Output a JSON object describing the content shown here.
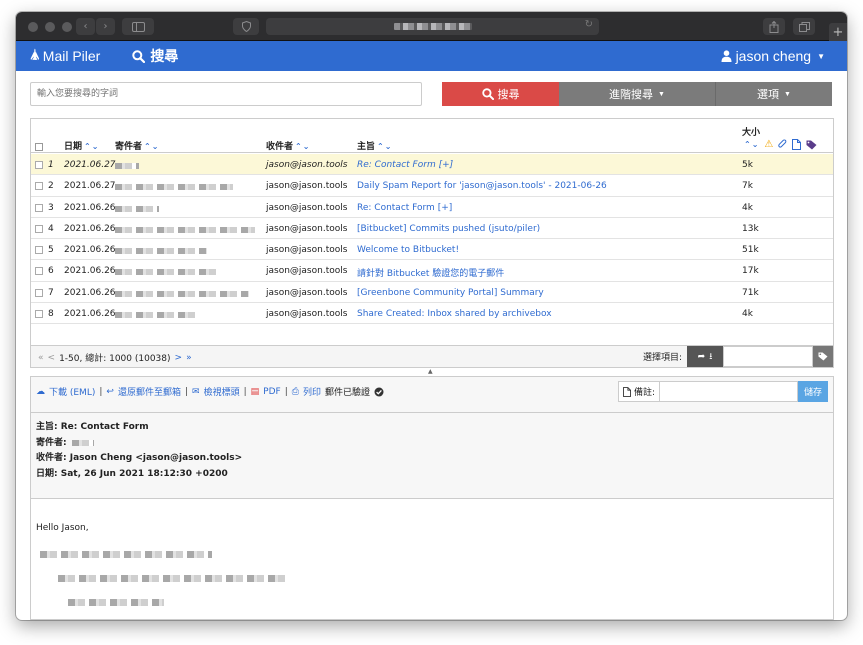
{
  "browser": {
    "reload_icon": "reload-icon",
    "share_icon": "share-icon"
  },
  "navbar": {
    "brand": "Mail Piler",
    "search_link": "搜尋",
    "user": "jason cheng"
  },
  "search": {
    "placeholder": "輸入您要搜尋的字詞",
    "search_button": "搜尋",
    "advanced_button": "進階搜尋",
    "options_button": "選項"
  },
  "columns": {
    "date": "日期",
    "from": "寄件者",
    "to": "收件者",
    "subject": "主旨",
    "size": "大小"
  },
  "messages": [
    {
      "num": "1",
      "date": "2021.06.27",
      "to": "jason@jason.tools",
      "subject": "Re: Contact Form [+]",
      "size": "5k",
      "selected": true
    },
    {
      "num": "2",
      "date": "2021.06.27",
      "to": "jason@jason.tools",
      "subject": "Daily Spam Report for 'jason@jason.tools' - 2021-06-26",
      "size": "7k"
    },
    {
      "num": "3",
      "date": "2021.06.26",
      "to": "jason@jason.tools",
      "subject": "Re: Contact Form [+]",
      "size": "4k"
    },
    {
      "num": "4",
      "date": "2021.06.26",
      "to": "jason@jason.tools",
      "subject": "[Bitbucket] Commits pushed (jsuto/piler)",
      "size": "13k"
    },
    {
      "num": "5",
      "date": "2021.06.26",
      "to": "jason@jason.tools",
      "subject": "Welcome to Bitbucket!",
      "size": "51k"
    },
    {
      "num": "6",
      "date": "2021.06.26",
      "to": "jason@jason.tools",
      "subject": "請針對 Bitbucket 驗證您的電子郵件",
      "size": "17k"
    },
    {
      "num": "7",
      "date": "2021.06.26",
      "to": "jason@jason.tools",
      "subject": "[Greenbone Community Portal] Summary",
      "size": "71k"
    },
    {
      "num": "8",
      "date": "2021.06.26",
      "to": "jason@jason.tools",
      "subject": "Share Created: Inbox shared by archivebox",
      "size": "4k"
    }
  ],
  "pager": {
    "first": "«",
    "prev": "<",
    "range": "1-50, 總計: 1000 (10038)",
    "next": ">",
    "last": "»",
    "select_label": "選擇項目:"
  },
  "preview": {
    "download": "下載 (EML)",
    "restore": "還原郵件至郵箱",
    "view_headers": "檢視標頭",
    "pdf": "PDF",
    "print": "列印",
    "verified": "郵件已驗證",
    "note_label": "備註:",
    "save": "儲存",
    "subject_line": "主旨: Re: Contact Form",
    "from_label": "寄件者:",
    "to_line": "收件者: Jason Cheng <jason@jason.tools>",
    "date_line": "日期: Sat, 26 Jun 2021 18:12:30 +0200",
    "greeting": "Hello Jason,"
  },
  "colors": {
    "navbar": "#2f6bd0",
    "search_button": "#da4a47",
    "gray_button": "#7b7b7b",
    "selected_row": "#fcf8d7",
    "link": "#2f6bd0",
    "save_button": "#5aa5e3"
  }
}
